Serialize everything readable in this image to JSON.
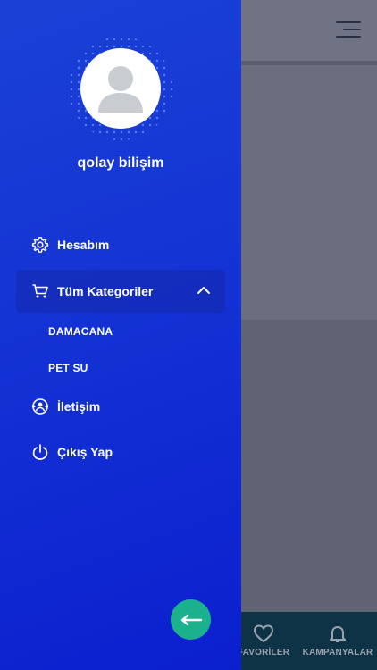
{
  "drawer": {
    "user_name": "qolay bilişim",
    "menu": {
      "account": "Hesabım",
      "categories": "Tüm Kategoriler",
      "contact": "İletişim",
      "logout": "Çıkış Yap"
    },
    "subcategories": [
      "DAMACANA",
      "PET SU"
    ]
  },
  "bottom_nav": {
    "favorites": "FAVORİLER",
    "campaigns": "KAMPANYALAR"
  },
  "colors": {
    "drawer_top": "#1a41d6",
    "drawer_bottom": "#0b1fcf",
    "fab": "#1cb18d",
    "bottom_bar": "#0e3346"
  },
  "icons": {
    "account": "gear-icon",
    "categories": "cart-icon",
    "contact": "support-icon",
    "logout": "power-icon",
    "back": "arrow-left-icon",
    "favorites": "heart-icon",
    "campaigns": "bell-icon"
  }
}
